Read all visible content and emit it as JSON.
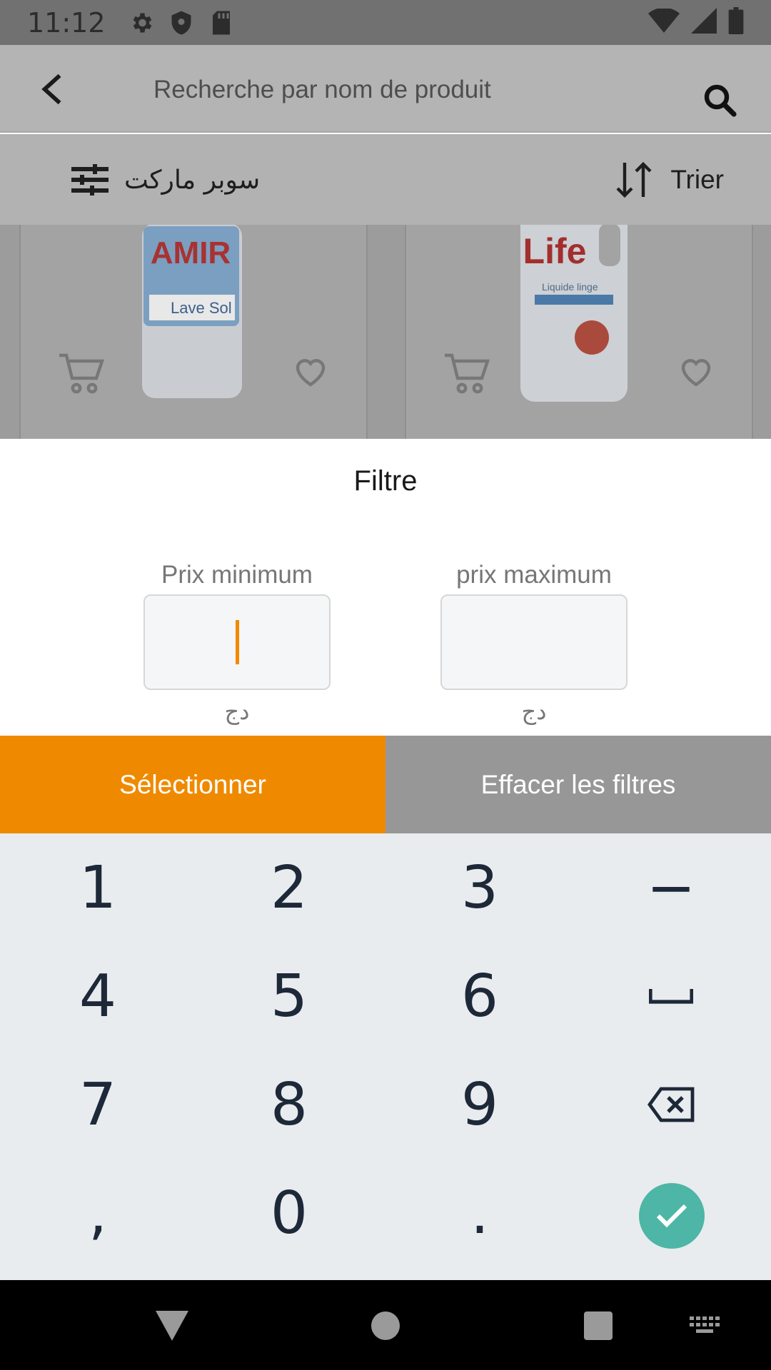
{
  "status_bar": {
    "time": "11:12"
  },
  "search": {
    "placeholder": "Recherche par nom de produit"
  },
  "filter_bar": {
    "filter_label": "سوبر ماركت",
    "sort_label": "Trier"
  },
  "products": [
    {
      "brand": "AMIR",
      "sublabel": "Lave Sol"
    },
    {
      "brand": "Life",
      "sublabel": "Liquide linge"
    }
  ],
  "sheet": {
    "title": "Filtre",
    "min_label": "Prix minimum",
    "max_label": "prix maximum",
    "min_value": "",
    "max_value": "",
    "currency": "دج"
  },
  "actions": {
    "select_label": "Sélectionner",
    "clear_label": "Effacer les filtres"
  },
  "keypad": {
    "keys": [
      "1",
      "2",
      "3",
      "−",
      "4",
      "5",
      "6",
      "␣",
      "7",
      "8",
      "9",
      "⌫",
      ",",
      "0",
      ".",
      "✓"
    ]
  },
  "colors": {
    "accent": "#ef8a00",
    "done": "#4db6a6",
    "keypad_bg": "#e9ecef",
    "clear_btn": "#979797"
  }
}
